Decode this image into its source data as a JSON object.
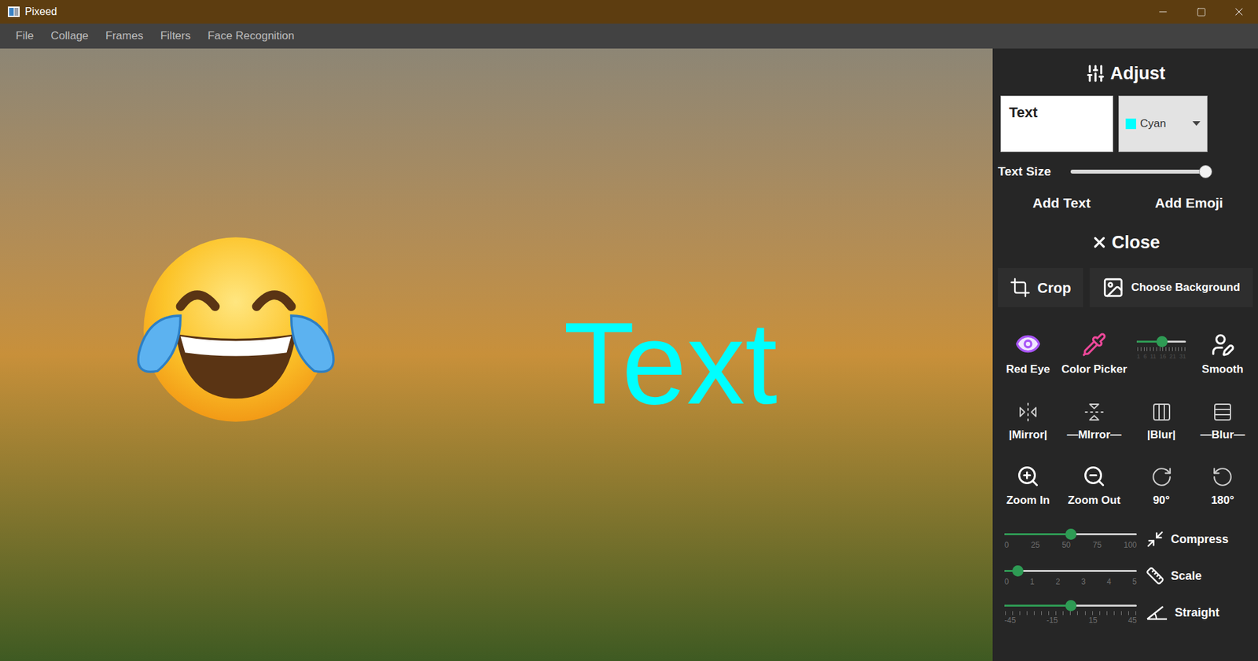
{
  "window": {
    "title": "Pixeed"
  },
  "menu": [
    "File",
    "Collage",
    "Frames",
    "Filters",
    "Face Recognition"
  ],
  "canvas": {
    "overlay_text": "Text"
  },
  "panel": {
    "title": "Adjust",
    "text_field": {
      "value": "Text"
    },
    "color_select": {
      "value": "Cyan",
      "color": "#00ffff"
    },
    "text_size": {
      "label": "Text Size",
      "level": 0.97
    },
    "actions": [
      "Add Text",
      "Add Emoji"
    ],
    "close": "Close",
    "crop": "Crop",
    "background": "Choose Background",
    "tools": [
      {
        "kind": "tool",
        "label": "Red Eye"
      },
      {
        "kind": "tool",
        "label": "Color Picker"
      },
      {
        "kind": "slider",
        "level": 0.5,
        "ticks": [
          "1",
          "6",
          "11",
          "16",
          "21",
          "31"
        ]
      },
      {
        "kind": "tool",
        "label": "Smooth"
      },
      {
        "kind": "tool",
        "label": "|Mirror|"
      },
      {
        "kind": "tool",
        "label": "—MIrror—"
      },
      {
        "kind": "tool",
        "label": "|Blur|"
      },
      {
        "kind": "tool",
        "label": "—Blur—"
      },
      {
        "kind": "tool",
        "label": "Zoom In"
      },
      {
        "kind": "tool",
        "label": "Zoom Out"
      },
      {
        "kind": "tool",
        "label": "90°"
      },
      {
        "kind": "tool",
        "label": "180°"
      }
    ],
    "adjusters": [
      {
        "label": "Compress",
        "level": 0.5,
        "ticks": [
          "0",
          "25",
          "50",
          "75",
          "100"
        ]
      },
      {
        "label": "Scale",
        "level": 0.1,
        "ticks": [
          "0",
          "1",
          "2",
          "3",
          "4",
          "5"
        ]
      },
      {
        "label": "Straight",
        "level": 0.5,
        "ticks": [
          "-45",
          "-15",
          "15",
          "45"
        ]
      }
    ]
  }
}
